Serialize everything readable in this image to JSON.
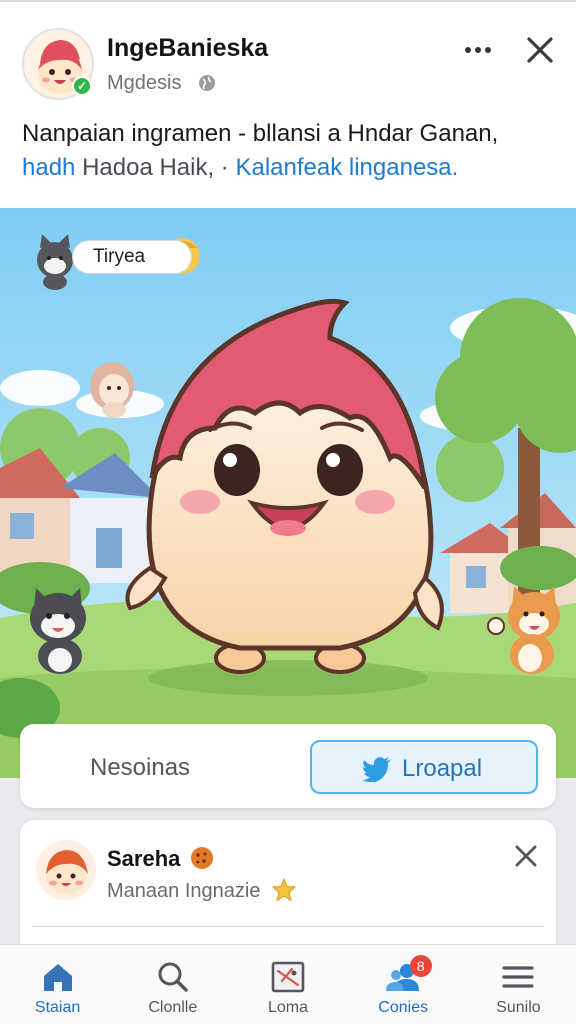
{
  "post": {
    "author_name": "IngeBanieska",
    "author_sub": "Mgdesis",
    "caption_line1": "Nanpaian ingramen - bllansi a Hndar Ganan,",
    "caption_line2_a": "hadh",
    "caption_line2_b": "Hadoa Haik, ·",
    "caption_line2_c": "Kalanfeak linganesa."
  },
  "scene": {
    "bubble_text": "Tiryea"
  },
  "actions": {
    "left_label": "Nesoinas",
    "right_label": "Lroapal",
    "right_icon": "bird-icon"
  },
  "comment": {
    "name": "Sareha",
    "subtitle": "Manaan Ingnazie"
  },
  "nav": {
    "items": [
      {
        "label": "Staian",
        "icon": "home-icon"
      },
      {
        "label": "Clonlle",
        "icon": "search-icon"
      },
      {
        "label": "Loma",
        "icon": "image-icon"
      },
      {
        "label": "Conies",
        "icon": "people-icon",
        "badge": "8"
      },
      {
        "label": "Sunilo",
        "icon": "menu-icon"
      }
    ]
  },
  "colors": {
    "accent": "#1d7bd6",
    "verified": "#2fb54a",
    "badge": "#e8463a"
  }
}
